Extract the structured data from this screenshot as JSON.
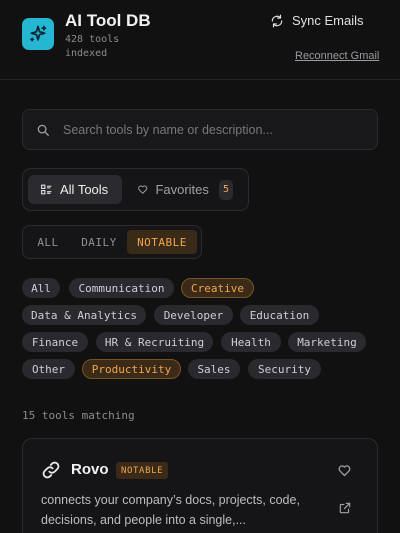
{
  "header": {
    "app_title": "AI Tool DB",
    "subtitle": "428 tools indexed",
    "sync_label": "Sync Emails",
    "reconnect_label": "Reconnect Gmail"
  },
  "search": {
    "placeholder": "Search tools by name or description...",
    "value": ""
  },
  "view_tabs": {
    "all_label": "All Tools",
    "favorites_label": "Favorites",
    "favorites_count": "5",
    "active": "All Tools"
  },
  "filter_tabs": {
    "items": [
      "ALL",
      "DAILY",
      "NOTABLE"
    ],
    "active": "NOTABLE"
  },
  "categories": {
    "items": [
      "All",
      "Communication",
      "Creative",
      "Data & Analytics",
      "Developer",
      "Education",
      "Finance",
      "HR & Recruiting",
      "Health",
      "Marketing",
      "Other",
      "Productivity",
      "Sales",
      "Security"
    ],
    "selected": [
      "Creative",
      "Productivity"
    ]
  },
  "results": {
    "count_text": "15 tools matching"
  },
  "cards": [
    {
      "name": "Rovo",
      "tag": "NOTABLE",
      "description": "connects your company’s docs, projects, code, decisions, and people into a single,..."
    }
  ],
  "colors": {
    "accent": "#f1a54e",
    "logo_bg": "#25b6d2",
    "background": "#111112"
  }
}
